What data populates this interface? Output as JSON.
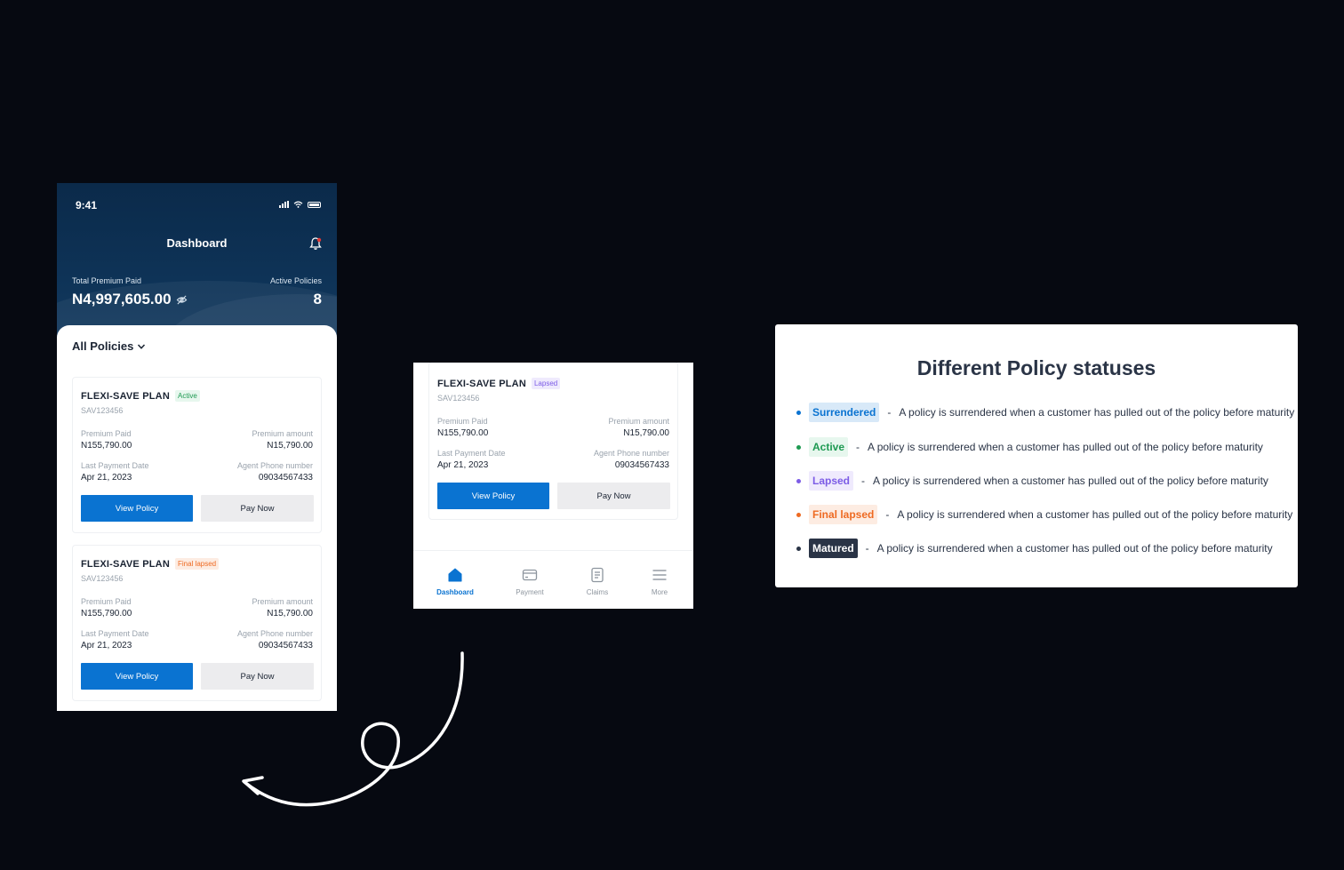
{
  "phone1": {
    "time": "9:41",
    "title": "Dashboard",
    "total_label": "Total Premium Paid",
    "total_amount": "N4,997,605.00",
    "active_label": "Active Policies",
    "active_count": "8",
    "all_policies": "All Policies",
    "cards": [
      {
        "plan": "FLEXI-SAVE PLAN",
        "badge": "Active",
        "code": "SAV123456",
        "premium_paid_label": "Premium Paid",
        "premium_paid": "N155,790.00",
        "premium_amount_label": "Premium amount",
        "premium_amount": "N15,790.00",
        "last_payment_label": "Last Payment Date",
        "last_payment": "Apr 21, 2023",
        "agent_label": "Agent Phone number",
        "agent_phone": "09034567433",
        "view": "View Policy",
        "pay": "Pay Now"
      },
      {
        "plan": "FLEXI-SAVE PLAN",
        "badge": "Final lapsed",
        "code": "SAV123456",
        "premium_paid_label": "Premium Paid",
        "premium_paid": "N155,790.00",
        "premium_amount_label": "Premium amount",
        "premium_amount": "N15,790.00",
        "last_payment_label": "Last Payment Date",
        "last_payment": "Apr 21, 2023",
        "agent_label": "Agent Phone number",
        "agent_phone": "09034567433",
        "view": "View Policy",
        "pay": "Pay Now"
      }
    ]
  },
  "phone2": {
    "card": {
      "plan": "FLEXI-SAVE PLAN",
      "badge": "Lapsed",
      "code": "SAV123456",
      "premium_paid_label": "Premium Paid",
      "premium_paid": "N155,790.00",
      "premium_amount_label": "Premium amount",
      "premium_amount": "N15,790.00",
      "last_payment_label": "Last Payment Date",
      "last_payment": "Apr 21, 2023",
      "agent_label": "Agent Phone number",
      "agent_phone": "09034567433",
      "view": "View Policy",
      "pay": "Pay Now"
    },
    "tabs": [
      "Dashboard",
      "Payment",
      "Claims",
      "More"
    ]
  },
  "legend": {
    "title": "Different Policy statuses",
    "items": [
      {
        "status": "Surrendered",
        "desc": "A policy is surrendered when a customer has pulled out of the policy before maturity",
        "color": "#0a73d1"
      },
      {
        "status": "Active",
        "desc": "A policy is surrendered when a customer has pulled out of the policy before maturity",
        "color": "#1e9a52"
      },
      {
        "status": "Lapsed",
        "desc": "A policy is surrendered when a customer has pulled out of the policy before maturity",
        "color": "#7c5ce6"
      },
      {
        "status": "Final lapsed",
        "desc": "A policy is surrendered when a customer has pulled out of the policy before maturity",
        "color": "#ee6a22"
      },
      {
        "status": "Matured",
        "desc": "A policy is surrendered when a customer has pulled out of the policy before maturity",
        "color": "#2a3446"
      }
    ],
    "separator": "-"
  },
  "colors": {
    "background": "#060911",
    "header": "#0e3357",
    "primary": "#0a73d1"
  }
}
